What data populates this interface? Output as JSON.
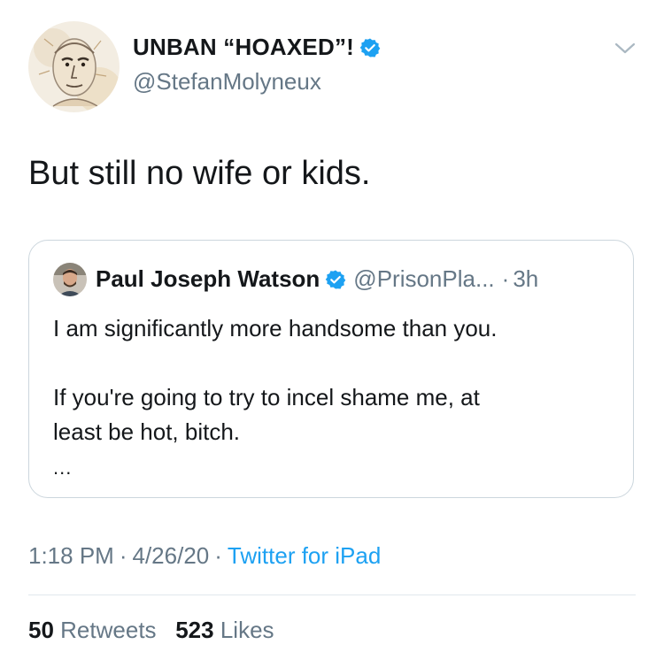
{
  "tweet": {
    "author_name": "UNBAN “HOAXED”!",
    "author_handle": "@StefanMolyneux",
    "text": "But still no wife or kids.",
    "timestamp_time": "1:18 PM",
    "timestamp_date": "4/26/20",
    "source": "Twitter for iPad",
    "separator": "·"
  },
  "quoted_tweet": {
    "author_name": "Paul Joseph Watson",
    "author_handle": "@PrisonPla...",
    "dot": "·",
    "time": "3h",
    "line1": "I am significantly more handsome than you.",
    "line2": "If you're going to try to incel shame me, at",
    "line3": "least be hot, bitch.",
    "ellipsis": "..."
  },
  "stats": {
    "retweets_count": "50",
    "retweets_label": "Retweets",
    "likes_count": "523",
    "likes_label": "Likes"
  },
  "colors": {
    "verified": "#1da1f2",
    "link": "#1da1f2",
    "secondary_text": "#657786",
    "border": "#ccd6dd"
  },
  "icons": {
    "verified": "verified-badge-icon",
    "caret": "chevron-down-icon"
  }
}
